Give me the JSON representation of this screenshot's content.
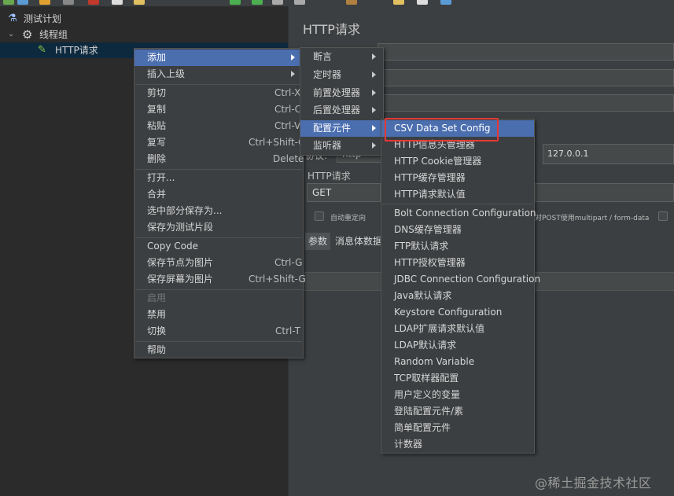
{
  "tree": {
    "items": [
      {
        "label": "测试计划",
        "icon": "flask-icon"
      },
      {
        "label": "线程组",
        "icon": "gear-icon"
      },
      {
        "label": "HTTP请求",
        "icon": "pen-icon"
      }
    ]
  },
  "panel": {
    "title": "HTTP请求",
    "protocol_label": "协议:",
    "protocol_value": "http",
    "server_value": "127.0.0.1",
    "http_request_label": "HTTP请求",
    "method_value": "GET",
    "checkbox_redirect": "自动重定向",
    "checkbox_multipart": "对POST使用multipart / form-data",
    "tabs": [
      "参数",
      "消息体数据"
    ]
  },
  "context_menu": {
    "items": [
      {
        "label": "添加",
        "shortcut": "",
        "submenu": true
      },
      {
        "label": "插入上级",
        "shortcut": "",
        "submenu": true
      },
      {
        "label": "剪切",
        "shortcut": "Ctrl-X"
      },
      {
        "label": "复制",
        "shortcut": "Ctrl-C"
      },
      {
        "label": "粘贴",
        "shortcut": "Ctrl-V"
      },
      {
        "label": "复写",
        "shortcut": "Ctrl+Shift-C"
      },
      {
        "label": "删除",
        "shortcut": "Delete"
      },
      {
        "label": "打开...",
        "shortcut": ""
      },
      {
        "label": "合并",
        "shortcut": ""
      },
      {
        "label": "选中部分保存为...",
        "shortcut": ""
      },
      {
        "label": "保存为测试片段",
        "shortcut": ""
      },
      {
        "label": "Copy Code",
        "shortcut": ""
      },
      {
        "label": "保存节点为图片",
        "shortcut": "Ctrl-G"
      },
      {
        "label": "保存屏幕为图片",
        "shortcut": "Ctrl+Shift-G"
      },
      {
        "label": "启用",
        "shortcut": ""
      },
      {
        "label": "禁用",
        "shortcut": ""
      },
      {
        "label": "切换",
        "shortcut": "Ctrl-T"
      },
      {
        "label": "帮助",
        "shortcut": ""
      }
    ]
  },
  "add_submenu": {
    "items": [
      "断言",
      "定时器",
      "前置处理器",
      "后置处理器",
      "配置元件",
      "监听器"
    ]
  },
  "config_submenu": {
    "items": [
      "CSV Data Set Config",
      "HTTP信息头管理器",
      "HTTP Cookie管理器",
      "HTTP缓存管理器",
      "HTTP请求默认值",
      "Bolt Connection Configuration",
      "DNS缓存管理器",
      "FTP默认请求",
      "HTTP授权管理器",
      "JDBC Connection Configuration",
      "Java默认请求",
      "Keystore Configuration",
      "LDAP扩展请求默认值",
      "LDAP默认请求",
      "Random Variable",
      "TCP取样器配置",
      "用户定义的变量",
      "登陆配置元件/素",
      "简单配置元件",
      "计数器"
    ]
  },
  "watermark": "@稀土掘金技术社区",
  "colors": {
    "highlight": "#4b6eaf",
    "annotation_box": "#e53935",
    "background": "#3c3f41"
  }
}
